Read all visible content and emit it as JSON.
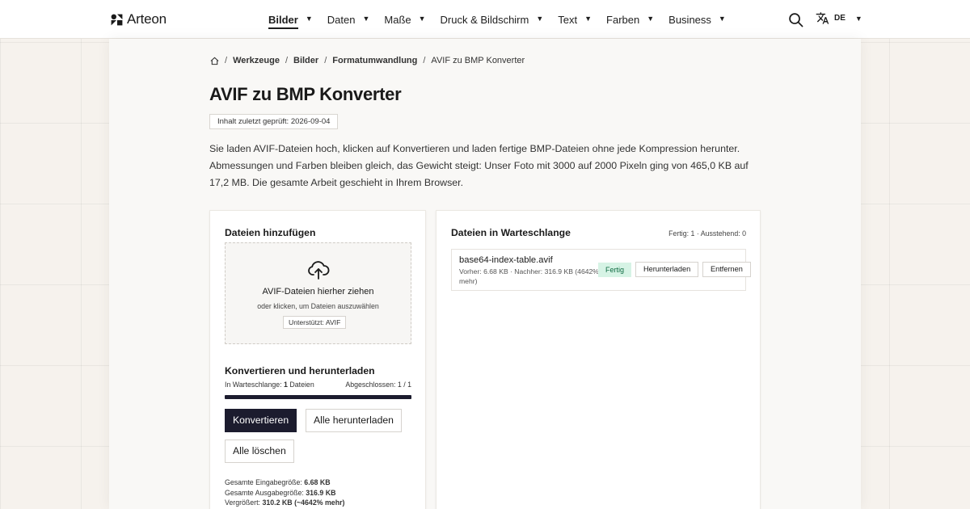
{
  "brand": {
    "name": "Arteon"
  },
  "nav": {
    "items": [
      {
        "label": "Bilder",
        "active": true
      },
      {
        "label": "Daten"
      },
      {
        "label": "Maße"
      },
      {
        "label": "Druck & Bildschirm"
      },
      {
        "label": "Text"
      },
      {
        "label": "Farben"
      },
      {
        "label": "Business"
      }
    ],
    "caret": "▼",
    "search_icon": "search-icon",
    "language": {
      "icon": "translate-icon",
      "label": "DE"
    }
  },
  "breadcrumb": {
    "home_icon": "home-icon",
    "separator": "/",
    "items": [
      "Werkzeuge",
      "Bilder",
      "Formatumwandlung"
    ],
    "current": "AVIF zu BMP Konverter"
  },
  "page": {
    "title": "AVIF zu BMP Konverter",
    "reviewed": "Inhalt zuletzt geprüft: 2026-09-04",
    "intro": "Sie laden AVIF-Dateien hoch, klicken auf Konvertieren und laden fertige BMP-Dateien ohne jede Kompression herunter. Abmessungen und Farben bleiben gleich, das Gewicht steigt: Unser Foto mit 3000 auf 2000 Pixeln ging von 465,0 KB auf 17,2 MB. Die gesamte Arbeit geschieht in Ihrem Browser."
  },
  "add_files": {
    "title": "Dateien hinzufügen",
    "drop_title": "AVIF-Dateien hierher ziehen",
    "drop_sub": "oder klicken, um Dateien auszuwählen",
    "supported": "Unterstützt: AVIF",
    "upload_icon": "cloud-upload-icon"
  },
  "convert": {
    "title": "Konvertieren und herunterladen",
    "queue_label": "In Warteschlange:",
    "queue_count": "1",
    "queue_unit": "Dateien",
    "done_label": "Abgeschlossen: 1 / 1",
    "progress": 1.0,
    "convert_button": "Konvertieren",
    "download_all_button": "Alle herunterladen",
    "clear_button": "Alle löschen",
    "totals": {
      "input_label": "Gesamte Eingabegröße:",
      "input_value": "6.68 KB",
      "output_label": "Gesamte Ausgabegröße:",
      "output_value": "316.9 KB",
      "growth_label": "Vergrößert:",
      "growth_value": "310.2 KB (~4642% mehr)"
    }
  },
  "queue": {
    "title": "Dateien in Warteschlange",
    "status": "Fertig: 1 · Ausstehend: 0",
    "files": [
      {
        "name": "base64-index-table.avif",
        "meta": "Vorher: 6.68 KB · Nachher: 316.9 KB (4642% mehr)",
        "badge": "Fertig",
        "download_label": "Herunterladen",
        "remove_label": "Entfernen"
      }
    ]
  },
  "colors": {
    "primary": "#1c1c2e",
    "success_bg": "#d6f3e5",
    "success_text": "#0f6b42"
  }
}
